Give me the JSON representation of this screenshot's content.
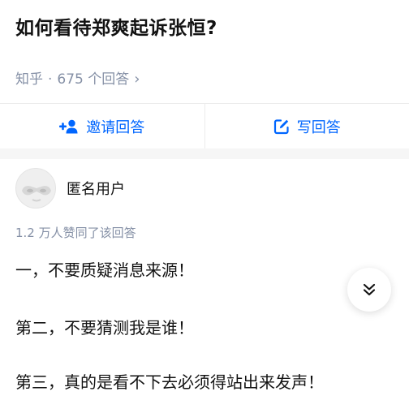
{
  "question": {
    "title": "如何看待郑爽起诉张恒?"
  },
  "meta": {
    "source": "知乎",
    "separator": "·",
    "answer_count": "675 个回答",
    "chevron": "›"
  },
  "actions": {
    "invite_label": "邀请回答",
    "write_label": "写回答",
    "accent_color": "#0066ff"
  },
  "answer": {
    "author_name": "匿名用户",
    "votes_text": "1.2 万人赞同了该回答",
    "lines": [
      "一，不要质疑消息来源！",
      "第二，不要猜测我是谁！",
      "第三，真的是看不下去必须得站出来发声！"
    ]
  },
  "icons": {
    "invite": "add-person-icon",
    "write": "edit-icon",
    "expand": "double-chevron-down-icon",
    "avatar": "anonymous-mask-avatar"
  }
}
